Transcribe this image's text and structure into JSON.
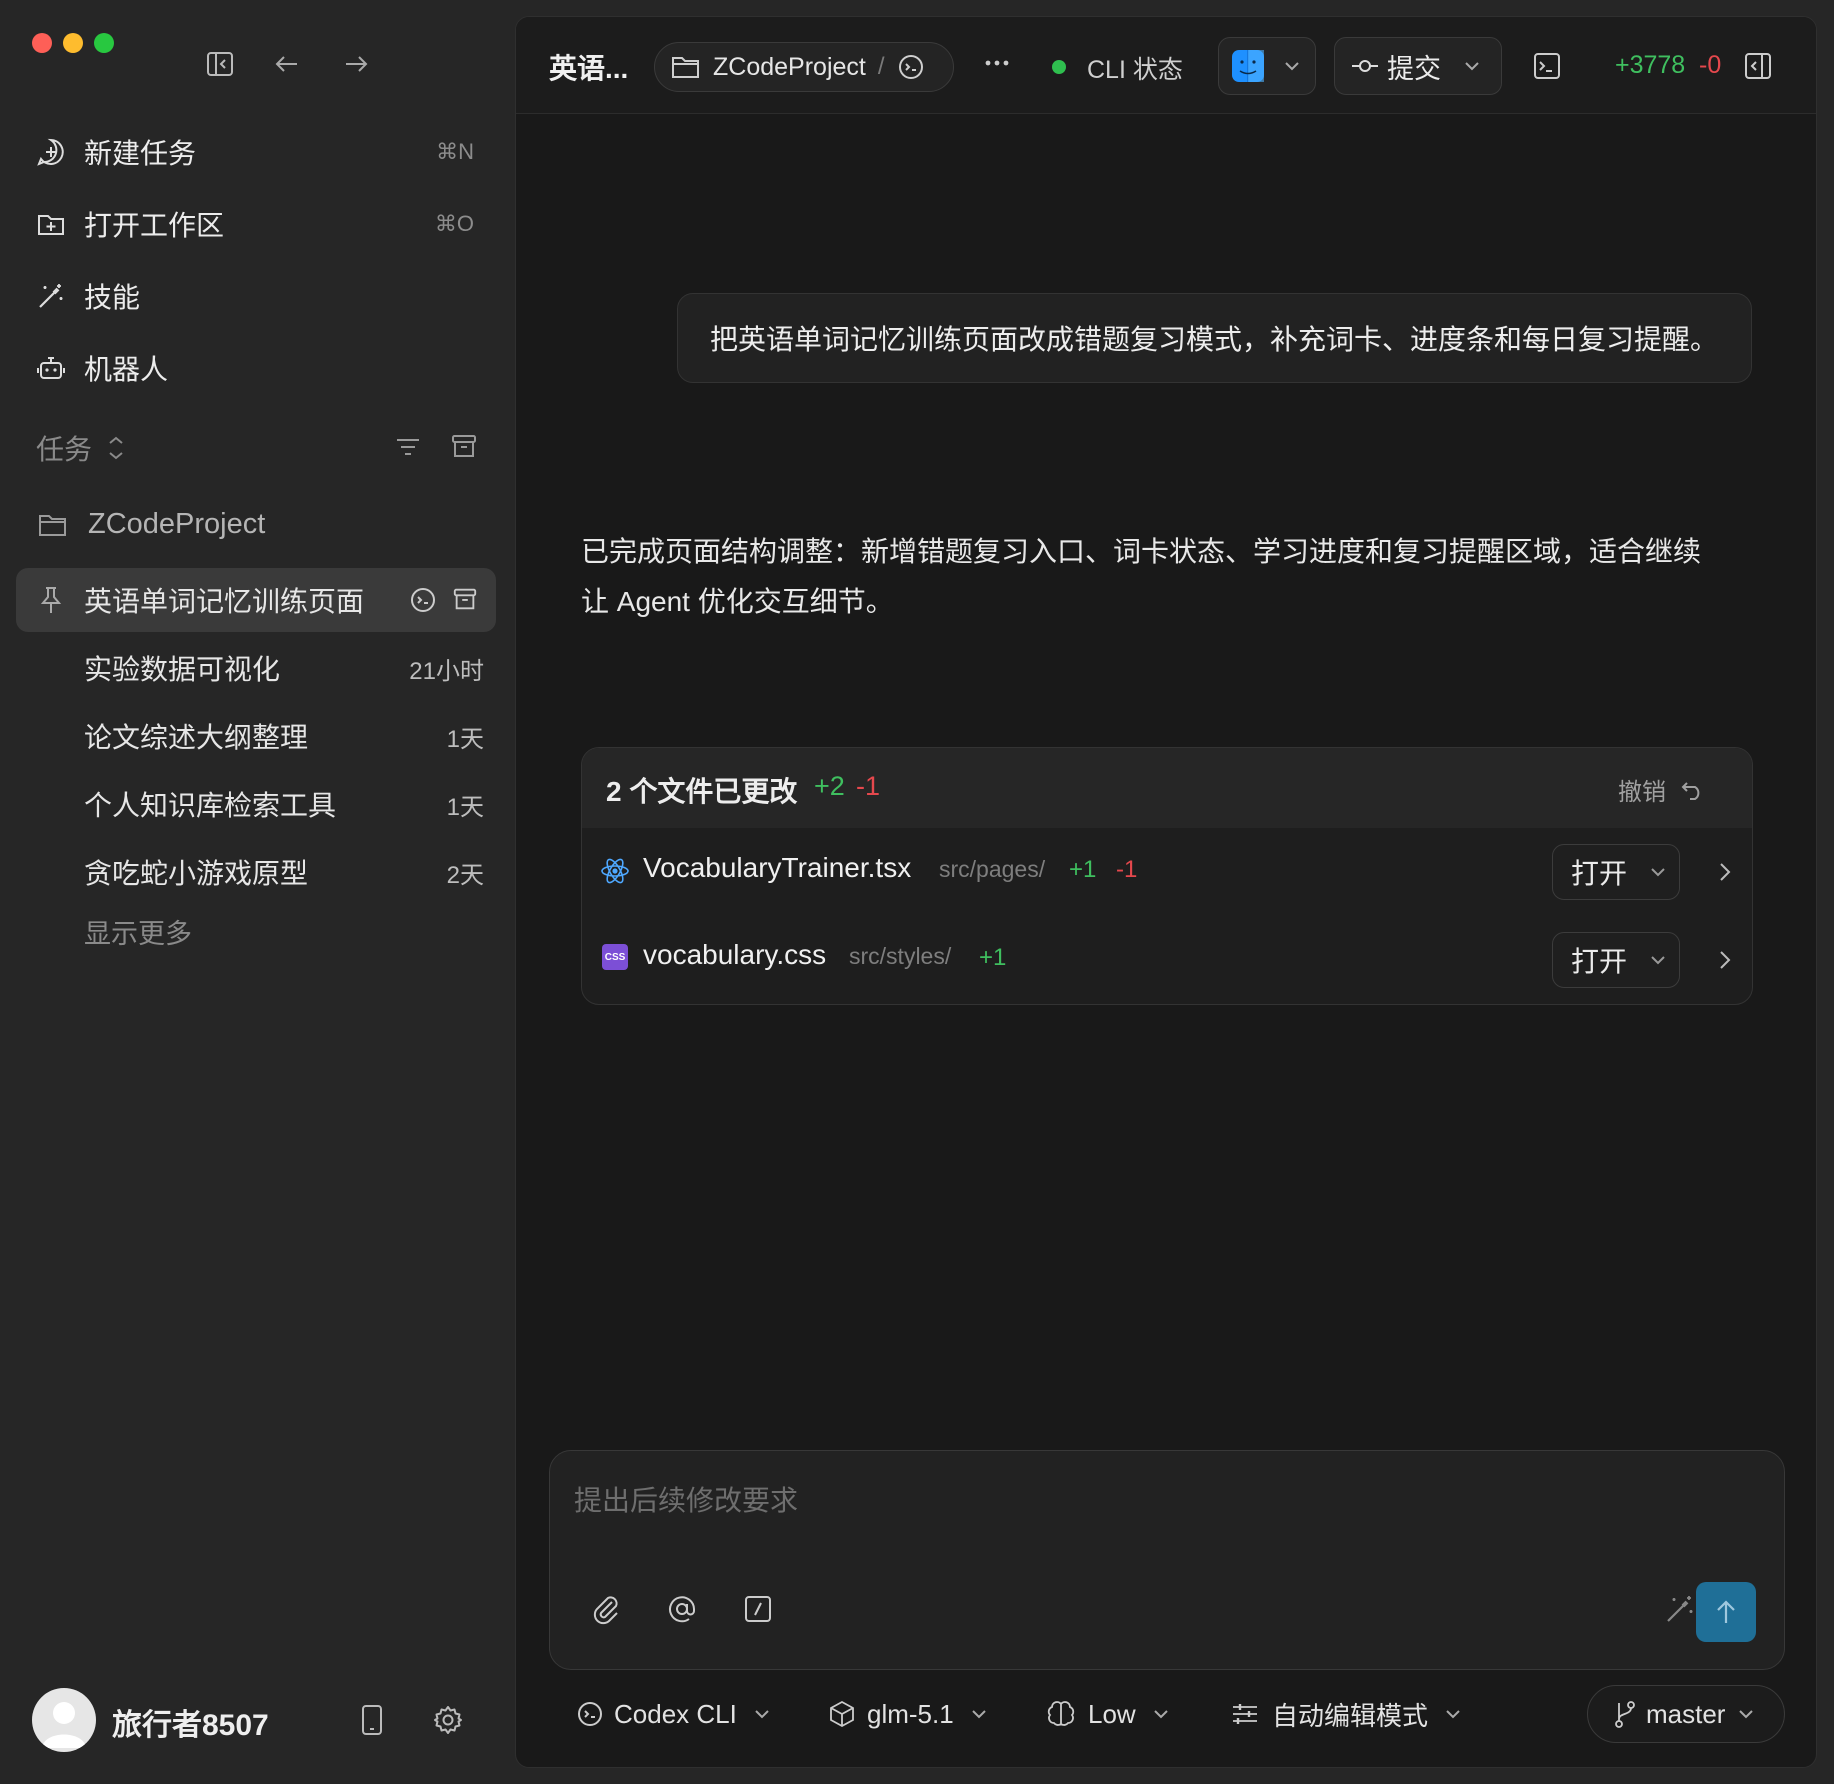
{
  "sidebar": {
    "nav": [
      {
        "label": "新建任务",
        "shortcut": "⌘N",
        "icon": "new-task-icon"
      },
      {
        "label": "打开工作区",
        "shortcut": "⌘O",
        "icon": "open-folder-icon"
      },
      {
        "label": "技能",
        "shortcut": "",
        "icon": "magic-wand-icon"
      },
      {
        "label": "机器人",
        "shortcut": "",
        "icon": "robot-icon"
      }
    ],
    "tasks_header": "任务",
    "project": "ZCodeProject",
    "tasks": [
      {
        "name": "英语单词记忆训练页面",
        "time": "",
        "active": true
      },
      {
        "name": "实验数据可视化",
        "time": "21小时"
      },
      {
        "name": "论文综述大纲整理",
        "time": "1天"
      },
      {
        "name": "个人知识库检索工具",
        "time": "1天"
      },
      {
        "name": "贪吃蛇小游戏原型",
        "time": "2天"
      }
    ],
    "show_more": "显示更多",
    "user_name": "旅行者8507"
  },
  "topbar": {
    "title": "英语...",
    "project": "ZCodeProject",
    "separator": "/",
    "cli_status": "CLI 状态",
    "commit_label": "提交",
    "diff_add": "+3778",
    "diff_del": "-0"
  },
  "chat": {
    "user_message": "把英语单词记忆训练页面改成错题复习模式，补充词卡、进度条和每日复习提醒。",
    "reply_line1": "已完成页面结构调整：新增错题复习入口、词卡状态、学习进度和复习提醒区域，适合继续",
    "reply_line2": "让 Agent 优化交互细节。"
  },
  "changes": {
    "title": "2 个文件已更改",
    "add": "+2",
    "del": "-1",
    "undo": "撤销",
    "files": [
      {
        "name": "VocabularyTrainer.tsx",
        "path": "src/pages/",
        "add": "+1",
        "del": "-1",
        "open": "打开"
      },
      {
        "name": "vocabulary.css",
        "path": "src/styles/",
        "add": "+1",
        "del": "",
        "open": "打开"
      }
    ]
  },
  "composer": {
    "placeholder": "提出后续修改要求"
  },
  "bottom": {
    "agent": "Codex CLI",
    "model": "glm-5.1",
    "effort": "Low",
    "mode": "自动编辑模式",
    "branch": "master"
  },
  "colors": {
    "accent": "#1f6f97",
    "green": "#3fbf5f",
    "red": "#e5484d"
  }
}
